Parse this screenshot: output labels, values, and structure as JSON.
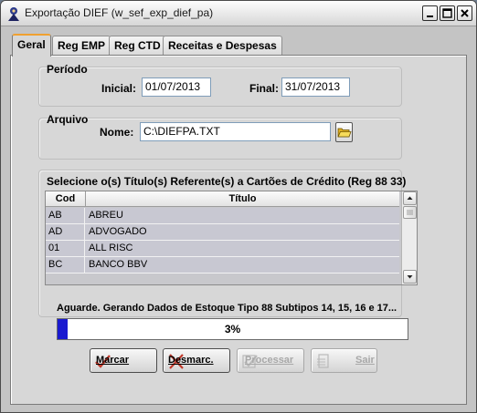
{
  "window": {
    "title": "Exportação DIEF (w_sef_exp_dief_pa)"
  },
  "tabs": [
    {
      "label": "Geral",
      "active": true
    },
    {
      "label": "Reg EMP",
      "active": false
    },
    {
      "label": "Reg CTD",
      "active": false
    },
    {
      "label": "Receitas e Despesas",
      "active": false
    }
  ],
  "periodo": {
    "title": "Período",
    "inicial_label": "Inicial:",
    "inicial_value": "01/07/2013",
    "final_label": "Final:",
    "final_value": "31/07/2013"
  },
  "arquivo": {
    "title": "Arquivo",
    "nome_label": "Nome:",
    "nome_value": "C:\\DIEFPA.TXT"
  },
  "cartoes": {
    "title": "Selecione o(s) Título(s) Referente(s) a Cartões de Crédito (Reg 88 33)",
    "columns": {
      "cod": "Cod",
      "titulo": "Título"
    },
    "rows": [
      {
        "cod": "AB",
        "titulo": "ABREU"
      },
      {
        "cod": "AD",
        "titulo": "ADVOGADO"
      },
      {
        "cod": "01",
        "titulo": "ALL RISC"
      },
      {
        "cod": "BC",
        "titulo": "BANCO BBV"
      }
    ]
  },
  "status": {
    "message": "Aguarde. Gerando Dados de Estoque Tipo 88 Subtipos 14, 15, 16 e 17...",
    "progress_text": "3%",
    "progress_fraction": 0.03
  },
  "buttons": {
    "marcar": {
      "label": "Marcar",
      "enabled": true
    },
    "desmarcar": {
      "label": "Desmarc.",
      "enabled": true
    },
    "processar": {
      "label": "Processar",
      "enabled": false
    },
    "sair": {
      "label": "Sair",
      "enabled": false
    }
  },
  "colors": {
    "progress_fill": "#1a1ad0",
    "row_background": "#c8c8d2",
    "active_tab_accent": "#f0a030"
  },
  "icons": {
    "app": "app-icon",
    "folder": "folder-open-icon",
    "marcar": "check-mark-icon",
    "desmarcar": "cross-mark-icon",
    "processar": "process-check-icon",
    "sair": "exit-door-icon"
  }
}
